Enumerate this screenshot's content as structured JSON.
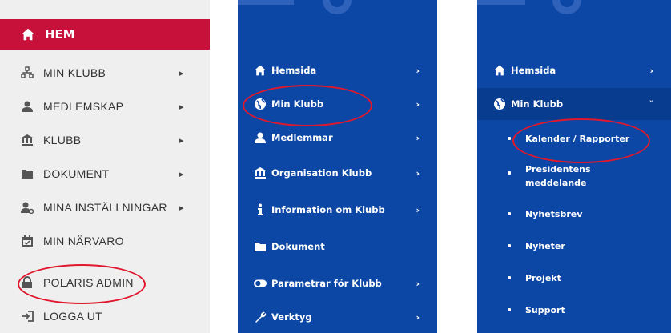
{
  "panel1": {
    "hem": "HEM",
    "items": [
      {
        "label": "MIN KLUBB",
        "icon": "sitemap-icon",
        "chev": "▸"
      },
      {
        "label": "MEDLEMSKAP",
        "icon": "user-icon",
        "chev": "▸"
      },
      {
        "label": "KLUBB",
        "icon": "institution-icon",
        "chev": "▸"
      },
      {
        "label": "DOKUMENT",
        "icon": "folder-icon",
        "chev": "▸"
      },
      {
        "label": "MINA INSTÄLLNINGAR",
        "icon": "user-cog-icon",
        "chev": "▸"
      },
      {
        "label": "MIN NÄRVARO",
        "icon": "calendar-icon"
      },
      {
        "label": "POLARIS ADMIN",
        "icon": "lock-icon"
      },
      {
        "label": "LOGGA UT",
        "icon": "logout-icon"
      }
    ]
  },
  "panel2": {
    "items": [
      {
        "label": "Hemsida",
        "icon": "home-icon",
        "chev": "›"
      },
      {
        "label": "Min Klubb",
        "icon": "globe-icon",
        "chev": "›"
      },
      {
        "label": "Medlemmar",
        "icon": "user-icon",
        "chev": "›"
      },
      {
        "label": "Organisation Klubb",
        "icon": "institution-icon",
        "chev": "›"
      },
      {
        "label": "Information om Klubb",
        "icon": "info-icon",
        "chev": "›"
      },
      {
        "label": "Dokument",
        "icon": "folder-icon"
      },
      {
        "label": "Parametrar för Klubb",
        "icon": "toggle-icon",
        "chev": "›"
      },
      {
        "label": "Verktyg",
        "icon": "wrench-icon",
        "chev": "›"
      }
    ]
  },
  "panel3": {
    "items": [
      {
        "label": "Hemsida",
        "icon": "home-icon",
        "chev": "›"
      },
      {
        "label": "Min Klubb",
        "icon": "globe-icon",
        "chev": "˅"
      }
    ],
    "subitems": [
      {
        "label": "Kalender / Rapporter"
      },
      {
        "label": "Presidentens",
        "label2": "meddelande"
      },
      {
        "label": "Nyhetsbrev"
      },
      {
        "label": "Nyheter"
      },
      {
        "label": "Projekt"
      },
      {
        "label": "Support"
      }
    ]
  },
  "colors": {
    "accent": "#c7113b",
    "blue": "#0d47a6",
    "highlight": "#e0182d"
  }
}
